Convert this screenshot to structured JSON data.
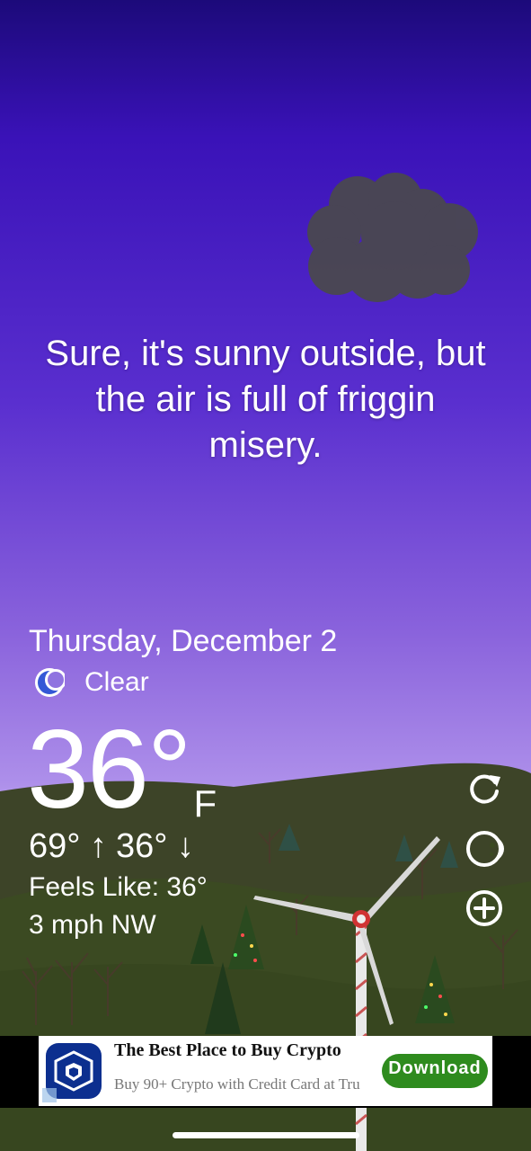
{
  "quote": "Sure, it's sunny outside, but the air is full of friggin misery.",
  "date": "Thursday, December 2",
  "condition": {
    "icon": "moon-icon",
    "label": "Clear"
  },
  "temperature": {
    "value": "36°",
    "unit": "F"
  },
  "high_low": {
    "high": "69° ↑",
    "low": "36° ↓"
  },
  "feels_like": "Feels Like: 36°",
  "wind": "3 mph NW",
  "actions": [
    {
      "icon": "refresh-icon"
    },
    {
      "icon": "moon-phase-icon"
    },
    {
      "icon": "add-location-icon"
    }
  ],
  "ad": {
    "title": "The Best Place to Buy Crypto",
    "subtitle": "Buy 90+ Crypto with Credit Card at Tru",
    "button": "Download"
  },
  "colors": {
    "sky_top": "#1c0a7a",
    "sky_bottom": "#c2a9f0",
    "hill": "#3c4427",
    "ad_button": "#2e8b1e"
  }
}
